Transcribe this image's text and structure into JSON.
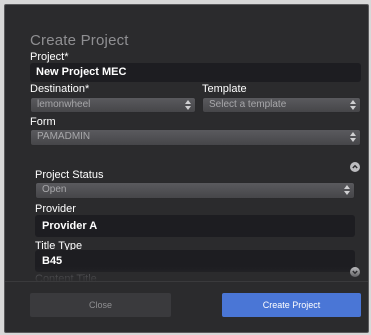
{
  "dialog": {
    "title": "Create Project"
  },
  "fields": {
    "project": {
      "label": "Project*",
      "value": "New Project MEC"
    },
    "destination": {
      "label": "Destination*",
      "value": "lemonwheel"
    },
    "template": {
      "label": "Template",
      "placeholder": "Select a template"
    },
    "form": {
      "label": "Form",
      "value": "PAMADMIN"
    },
    "project_status": {
      "label": "Project Status",
      "value": "Open"
    },
    "provider": {
      "label": "Provider",
      "value": "Provider A"
    },
    "title_type": {
      "label": "Title Type",
      "value": "B45"
    },
    "partial_next_label": "Content Title"
  },
  "buttons": {
    "close": "Close",
    "create": "Create Project"
  },
  "icons": {
    "collapse_section": "chevron-up-circle-icon",
    "expand_section": "chevron-down-circle-icon",
    "select_arrows": "up-down-arrows-icon"
  },
  "colors": {
    "dialog_bg": "#2b2b2d",
    "input_bg": "#1d1d21",
    "primary_button": "#4a76d6",
    "secondary_button": "#3a3a3d",
    "title_text": "#8f8f92"
  }
}
